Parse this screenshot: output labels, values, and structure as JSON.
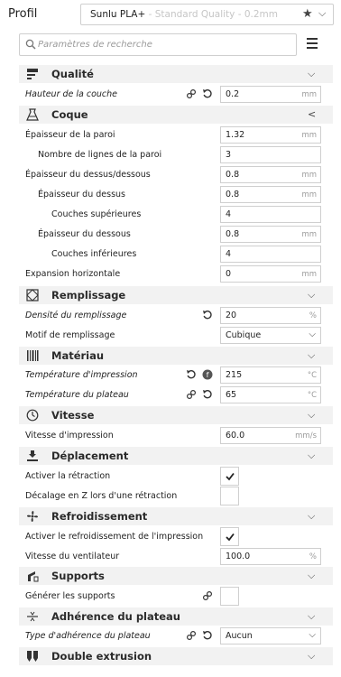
{
  "profile": {
    "label": "Profil",
    "material": "Sunlu PLA+",
    "quality": " - Standard Quality - 0.2mm"
  },
  "search": {
    "placeholder": "Paramètres de recherche"
  },
  "sections": {
    "quality": {
      "title": "Qualité",
      "layer_height": {
        "label": "Hauteur de la couche",
        "value": "0.2",
        "unit": "mm"
      }
    },
    "shell": {
      "title": "Coque",
      "wall_thickness": {
        "label": "Épaisseur de la paroi",
        "value": "1.32",
        "unit": "mm"
      },
      "wall_line_count": {
        "label": "Nombre de lignes de la paroi",
        "value": "3"
      },
      "top_bottom_thickness": {
        "label": "Épaisseur du dessus/dessous",
        "value": "0.8",
        "unit": "mm"
      },
      "top_thickness": {
        "label": "Épaisseur du dessus",
        "value": "0.8",
        "unit": "mm"
      },
      "top_layers": {
        "label": "Couches supérieures",
        "value": "4"
      },
      "bottom_thickness": {
        "label": "Épaisseur du dessous",
        "value": "0.8",
        "unit": "mm"
      },
      "bottom_layers": {
        "label": "Couches inférieures",
        "value": "4"
      },
      "horizontal_expansion": {
        "label": "Expansion horizontale",
        "value": "0",
        "unit": "mm"
      }
    },
    "infill": {
      "title": "Remplissage",
      "density": {
        "label": "Densité du remplissage",
        "value": "20",
        "unit": "%"
      },
      "pattern": {
        "label": "Motif de remplissage",
        "value": "Cubique"
      }
    },
    "material": {
      "title": "Matériau",
      "print_temp": {
        "label": "Température d'impression",
        "value": "215",
        "unit": "°C"
      },
      "bed_temp": {
        "label": "Température du plateau",
        "value": "65",
        "unit": "°C"
      }
    },
    "speed": {
      "title": "Vitesse",
      "print_speed": {
        "label": "Vitesse d'impression",
        "value": "60.0",
        "unit": "mm/s"
      }
    },
    "travel": {
      "title": "Déplacement",
      "retraction": {
        "label": "Activer la rétraction",
        "checked": true
      },
      "z_hop": {
        "label": "Décalage en Z lors d'une rétraction",
        "checked": false
      }
    },
    "cooling": {
      "title": "Refroidissement",
      "enable_cooling": {
        "label": "Activer le refroidissement de l'impression",
        "checked": true
      },
      "fan_speed": {
        "label": "Vitesse du ventilateur",
        "value": "100.0",
        "unit": "%"
      }
    },
    "supports": {
      "title": "Supports",
      "generate": {
        "label": "Générer les supports",
        "checked": false
      }
    },
    "adhesion": {
      "title": "Adhérence du plateau",
      "type": {
        "label": "Type d'adhérence du plateau",
        "value": "Aucun"
      }
    },
    "dual": {
      "title": "Double extrusion"
    }
  },
  "colors": {
    "header_bg": "#f2f2f2",
    "border": "#cfcfcf",
    "placeholder": "#9a9a9a"
  }
}
